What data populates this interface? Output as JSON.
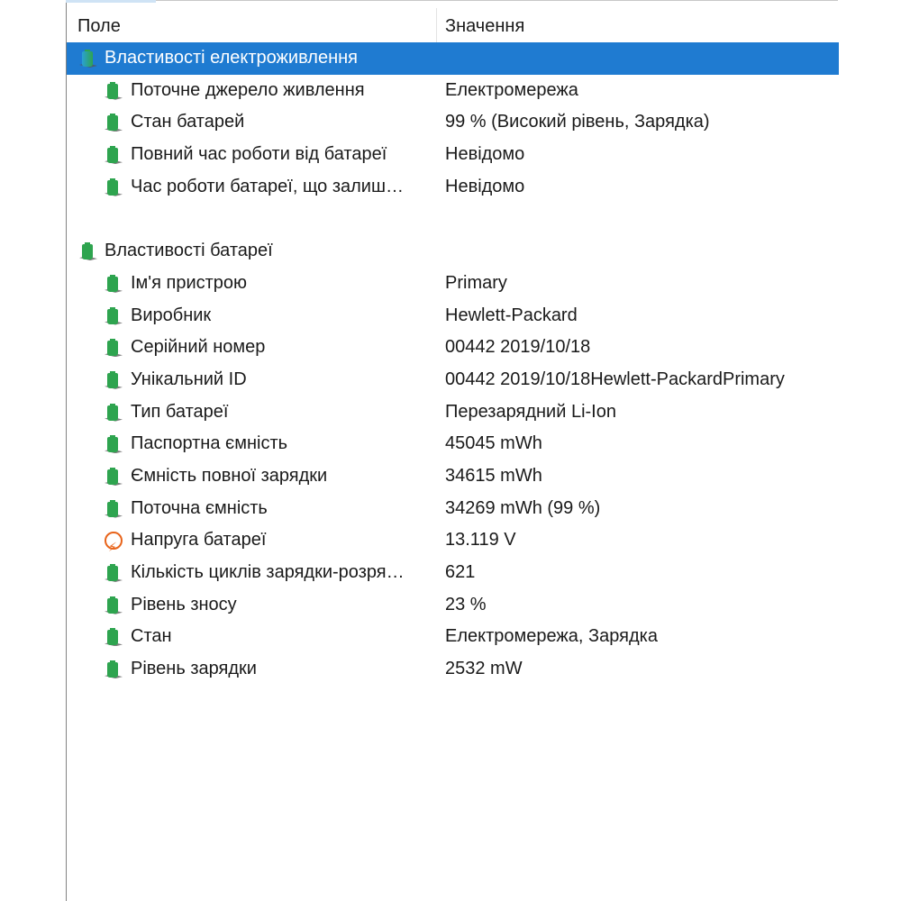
{
  "columns": {
    "field": "Поле",
    "value": "Значення"
  },
  "groups": [
    {
      "title": "Властивості електроживлення",
      "icon": "battery-icon",
      "selected": true,
      "items": [
        {
          "label": "Поточне джерело живлення",
          "value": "Електромережа",
          "icon": "battery-icon"
        },
        {
          "label": "Стан батарей",
          "value": "99 % (Високий рівень, Зарядка)",
          "icon": "battery-icon"
        },
        {
          "label": "Повний час роботи від батареї",
          "value": "Невідомо",
          "icon": "battery-icon"
        },
        {
          "label": "Час роботи батареї, що залиш…",
          "value": "Невідомо",
          "icon": "battery-icon"
        }
      ]
    },
    {
      "title": "Властивості батареї",
      "icon": "battery-icon",
      "selected": false,
      "items": [
        {
          "label": "Ім'я пристрою",
          "value": "Primary",
          "icon": "battery-icon"
        },
        {
          "label": "Виробник",
          "value": "Hewlett-Packard",
          "icon": "battery-icon"
        },
        {
          "label": "Серійний номер",
          "value": "00442 2019/10/18",
          "icon": "battery-icon"
        },
        {
          "label": "Унікальний ID",
          "value": "00442 2019/10/18Hewlett-PackardPrimary",
          "icon": "battery-icon"
        },
        {
          "label": "Тип батареї",
          "value": "Перезарядний Li-Ion",
          "icon": "battery-icon"
        },
        {
          "label": "Паспортна ємність",
          "value": "45045 mWh",
          "icon": "battery-icon"
        },
        {
          "label": "Ємність повної зарядки",
          "value": "34615 mWh",
          "icon": "battery-icon"
        },
        {
          "label": "Поточна ємність",
          "value": "34269 mWh  (99 %)",
          "icon": "battery-icon"
        },
        {
          "label": "Напруга батареї",
          "value": "13.119 V",
          "icon": "voltage-icon"
        },
        {
          "label": "Кількість циклів зарядки-розря…",
          "value": "621",
          "icon": "battery-icon"
        },
        {
          "label": "Рівень зносу",
          "value": "23 %",
          "icon": "battery-icon"
        },
        {
          "label": "Стан",
          "value": "Електромережа, Зарядка",
          "icon": "battery-icon"
        },
        {
          "label": "Рівень зарядки",
          "value": "2532 mW",
          "icon": "battery-icon"
        }
      ]
    }
  ],
  "colors": {
    "selection": "#1f7bd1",
    "battery_green": "#2ea44f",
    "voltage_orange": "#e8641b"
  }
}
